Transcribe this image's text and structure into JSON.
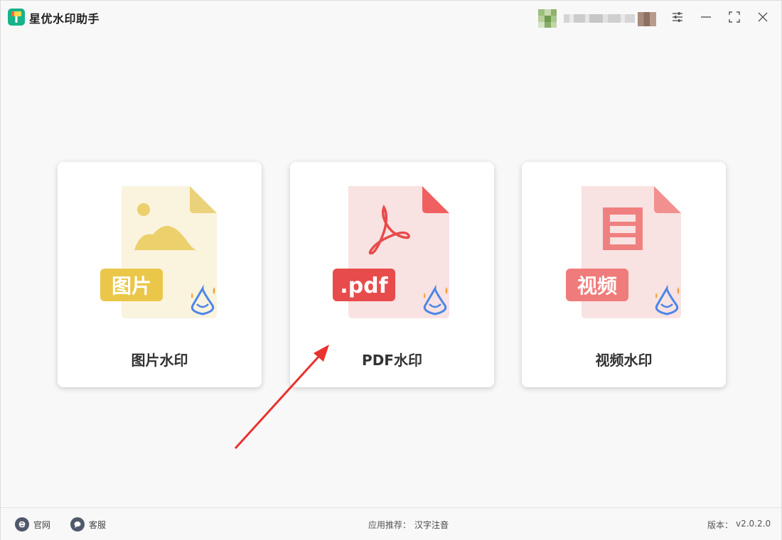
{
  "app": {
    "title": "星优水印助手"
  },
  "cards": [
    {
      "id": "image",
      "label": "图片水印",
      "badge": "图片",
      "accent": "#eac748"
    },
    {
      "id": "pdf",
      "label": "PDF水印",
      "badge": ".pdf",
      "accent": "#e84b4b"
    },
    {
      "id": "video",
      "label": "视频水印",
      "badge": "视频",
      "accent": "#f07b7b"
    }
  ],
  "footer": {
    "website_label": "官网",
    "support_label": "客服",
    "recommend_label": "应用推荐：",
    "recommend_app": "汉字注音",
    "version_label": "版本：",
    "version": "v2.0.2.0"
  },
  "icons": {
    "settings": "sliders-icon",
    "minimize": "minimize-icon",
    "maximize": "maximize-icon",
    "close": "close-icon"
  },
  "colors": {
    "brand": "#17b38a",
    "annotation_arrow": "#e8322e",
    "footer_icon": "#50596b"
  }
}
